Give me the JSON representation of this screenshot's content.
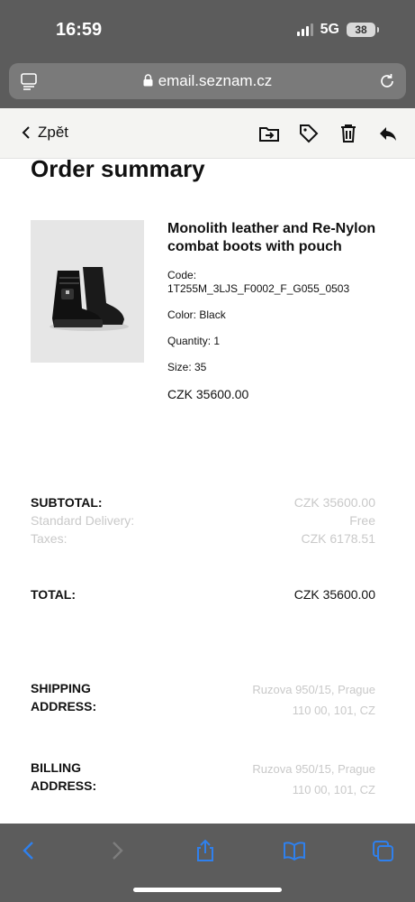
{
  "status_bar": {
    "time": "16:59",
    "network": "5G",
    "battery": "38"
  },
  "url_bar": {
    "url": "email.seznam.cz"
  },
  "mail_toolbar": {
    "back_label": "Zpět"
  },
  "email": {
    "title": "Order summary",
    "product": {
      "name": "Monolith leather and Re-Nylon combat boots with pouch",
      "code_label": "Code:",
      "code": "1T255M_3LJS_F0002_F_G055_0503",
      "color": "Color: Black",
      "quantity": "Quantity: 1",
      "size": "Size: 35",
      "price": "CZK 35600.00"
    },
    "totals": {
      "subtotal_label": "SUBTOTAL:",
      "subtotal_value": "CZK 35600.00",
      "delivery_label": "Standard Delivery:",
      "delivery_value": "Free",
      "taxes_label": "Taxes:",
      "taxes_value": "CZK 6178.51",
      "total_label": "TOTAL:",
      "total_value": "CZK 35600.00"
    },
    "shipping": {
      "label_line1": "SHIPPING",
      "label_line2": "ADDRESS:",
      "line1": "Ruzova 950/15, Prague",
      "line2": "110 00, 101, CZ"
    },
    "billing": {
      "label_line1": "BILLING",
      "label_line2": "ADDRESS:",
      "line1": "Ruzova 950/15, Prague",
      "line2": "110 00, 101, CZ"
    }
  },
  "colors": {
    "chrome": "#5c5c5c",
    "accent_blue": "#2f80ed",
    "muted_text": "#c9c9c9"
  }
}
